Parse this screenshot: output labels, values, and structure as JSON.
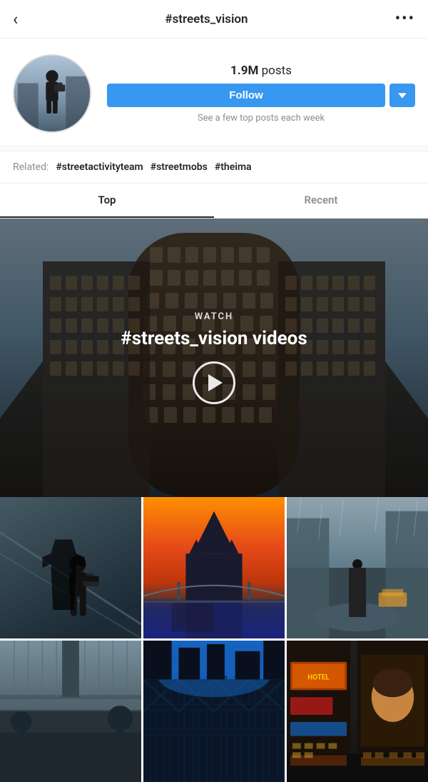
{
  "header": {
    "back_icon": "‹",
    "title": "#streets_vision",
    "more_icon": "···"
  },
  "profile": {
    "posts_count": "1.9M",
    "posts_label": "posts",
    "follow_label": "Follow",
    "dropdown_icon": "▾",
    "hint": "See a few top posts each week"
  },
  "related": {
    "label": "Related:",
    "tags": [
      "#streetactivityteam",
      "#streetmobs",
      "#theima"
    ]
  },
  "tabs": [
    {
      "label": "Top",
      "active": true
    },
    {
      "label": "Recent",
      "active": false
    }
  ],
  "video_banner": {
    "watch_label": "WATCH",
    "title": "#streets_vision videos",
    "play_icon": "play"
  },
  "grid": {
    "items": [
      {
        "id": 1,
        "alt": "photographer with camera"
      },
      {
        "id": 2,
        "alt": "city skyline at sunset"
      },
      {
        "id": 3,
        "alt": "person in rainy city street"
      },
      {
        "id": 4,
        "alt": "bridge architecture"
      },
      {
        "id": 5,
        "alt": "dark urban scene"
      },
      {
        "id": 6,
        "alt": "neon signs city night"
      }
    ]
  },
  "colors": {
    "follow_blue": "#3897f0",
    "tab_active": "#262626",
    "tab_inactive": "#8e8e8e"
  }
}
